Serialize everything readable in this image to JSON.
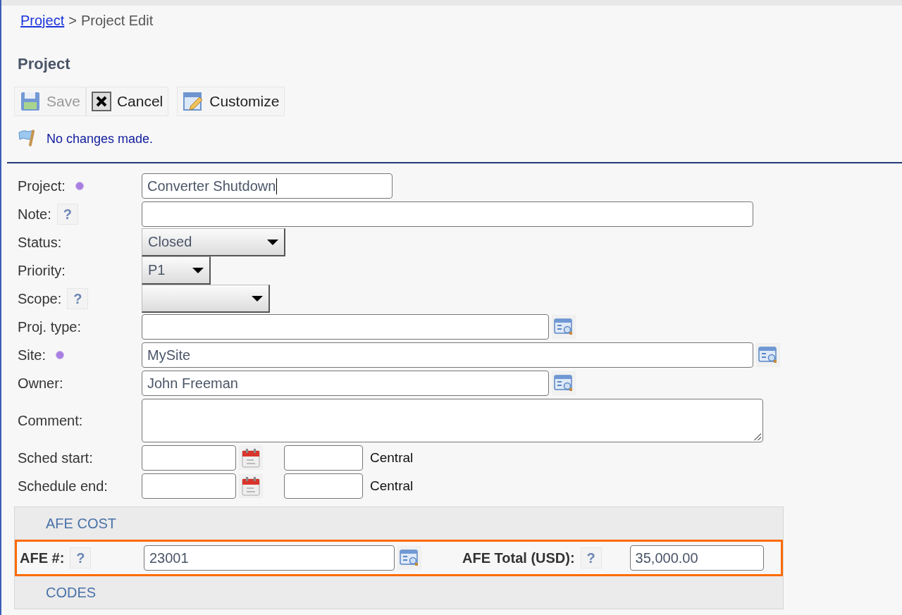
{
  "breadcrumb": {
    "link": "Project",
    "separator": ">",
    "current": "Project Edit"
  },
  "heading": "Project",
  "toolbar": [
    {
      "kind": "save",
      "label": "Save",
      "disabled": true
    },
    {
      "kind": "cancel",
      "label": "Cancel",
      "disabled": false
    },
    {
      "kind": "customize",
      "label": "Customize",
      "disabled": false
    }
  ],
  "message": "No changes made.",
  "fields": [
    {
      "kind": "text",
      "label": "Project:",
      "required": true,
      "value": "Converter Shutdown",
      "focused": true,
      "lookup": false
    },
    {
      "kind": "text",
      "label": "Note:",
      "help": "?",
      "required": false,
      "focused": false,
      "lookup": false
    },
    {
      "kind": "select",
      "label": "Status:",
      "required": false,
      "value": "Closed"
    },
    {
      "kind": "select",
      "label": "Priority:",
      "required": false,
      "value": "P1"
    },
    {
      "kind": "select",
      "label": "Scope:",
      "help": "?",
      "required": false
    },
    {
      "kind": "text",
      "label": "Proj. type:",
      "required": false,
      "focused": false,
      "lookup": true
    },
    {
      "kind": "text",
      "label": "Site:",
      "required": true,
      "value": "MySite",
      "focused": false,
      "lookup": true
    },
    {
      "kind": "text",
      "label": "Owner:",
      "required": false,
      "value": "John Freeman",
      "focused": false,
      "lookup": true
    },
    {
      "kind": "textarea",
      "label": "Comment:",
      "required": false
    },
    {
      "kind": "date",
      "label": "Sched start:",
      "required": false,
      "zone": "Central"
    },
    {
      "kind": "date",
      "label": "Schedule end:",
      "required": false,
      "zone": "Central"
    }
  ],
  "sections": [
    {
      "title": "AFE COST",
      "rows": [
        {
          "highlighted": true,
          "fields": [
            {
              "label": "AFE #:",
              "help": "?",
              "value": "23001",
              "lookup": true
            },
            {
              "label": "AFE Total (USD):",
              "help": "?",
              "value": "35,000.00",
              "lookup": false
            }
          ]
        }
      ]
    },
    {
      "title": "CODES"
    }
  ]
}
